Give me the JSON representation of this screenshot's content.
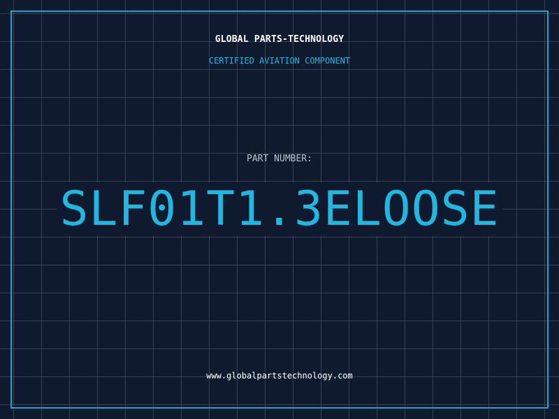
{
  "header": {
    "company": "GLOBAL PARTS-TECHNOLOGY",
    "subtitle": "CERTIFIED AVIATION COMPONENT"
  },
  "part": {
    "label": "PART NUMBER:",
    "number": "SLF01T1.3ELOOSE"
  },
  "footer": {
    "website": "www.globalpartstechnology.com"
  },
  "colors": {
    "background": "#0f1a2e",
    "grid": "#2d6e8c",
    "frame": "#1fa3cc",
    "accent": "#20b8e0"
  }
}
